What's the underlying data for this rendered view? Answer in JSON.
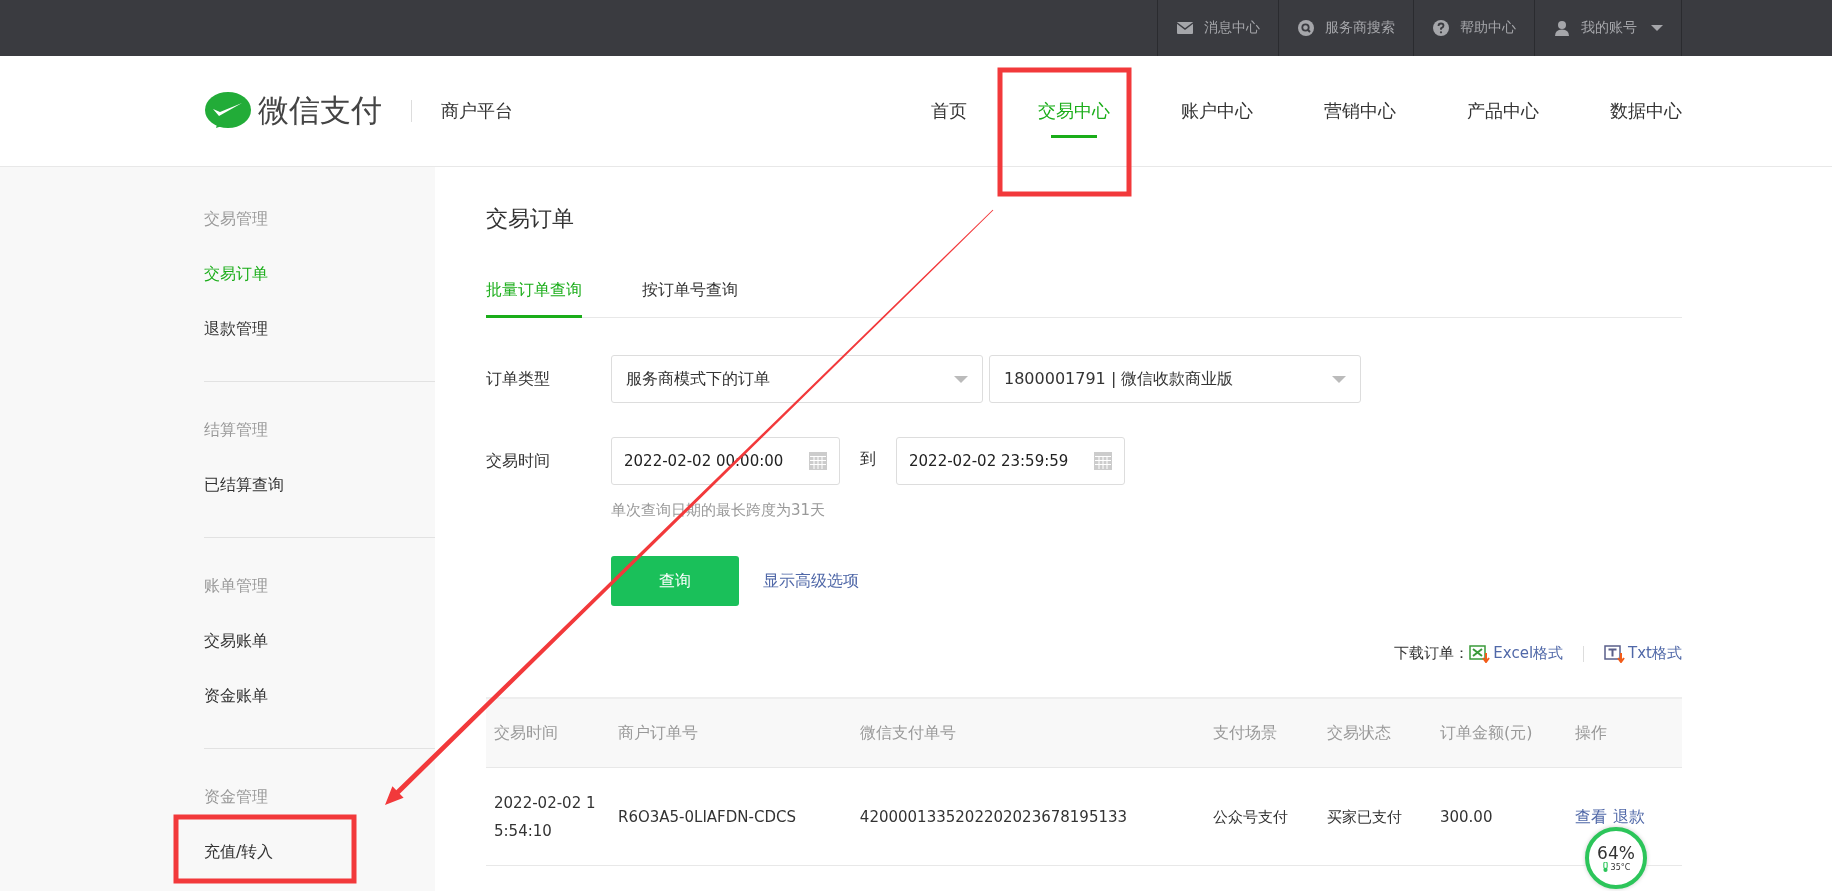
{
  "top_bar": {
    "items": [
      {
        "kind": "mail",
        "label": "消息中心"
      },
      {
        "kind": "search",
        "label": "服务商搜索"
      },
      {
        "kind": "help",
        "label": "帮助中心"
      },
      {
        "kind": "account",
        "label": "我的账号"
      }
    ]
  },
  "header": {
    "logo_text": "微信支付",
    "platform": "商户平台",
    "nav": [
      {
        "label": "首页",
        "selected": false
      },
      {
        "label": "交易中心",
        "selected": true
      },
      {
        "label": "账户中心",
        "selected": false
      },
      {
        "label": "营销中心",
        "selected": false
      },
      {
        "label": "产品中心",
        "selected": false
      },
      {
        "label": "数据中心",
        "selected": false
      }
    ]
  },
  "sidebar": {
    "groups": [
      {
        "title": "交易管理",
        "items": [
          {
            "label": "交易订单",
            "selected": true
          },
          {
            "label": "退款管理",
            "selected": false
          }
        ]
      },
      {
        "title": "结算管理",
        "items": [
          {
            "label": "已结算查询",
            "selected": false
          }
        ]
      },
      {
        "title": "账单管理",
        "items": [
          {
            "label": "交易账单",
            "selected": false
          },
          {
            "label": "资金账单",
            "selected": false
          }
        ]
      },
      {
        "title": "资金管理",
        "items": [
          {
            "label": "充值/转入",
            "selected": false
          }
        ]
      }
    ]
  },
  "page": {
    "title": "交易订单",
    "tabs": [
      {
        "label": "批量订单查询",
        "selected": true
      },
      {
        "label": "按订单号查询",
        "selected": false
      }
    ],
    "order_type": {
      "label": "订单类型",
      "selects": [
        "服务商模式下的订单",
        "1800001791 | 微信收款商业版"
      ]
    },
    "time": {
      "label": "交易时间",
      "start": "2022-02-02 00:00:00",
      "separator": "到",
      "end": "2022-02-02 23:59:59",
      "hint": "单次查询日期的最长跨度为31天"
    },
    "query_button": "查询",
    "advanced_link": "显示高级选项",
    "download": {
      "label": "下载订单：",
      "links": [
        {
          "kind": "excel",
          "label": "Excel格式"
        },
        {
          "kind": "txt",
          "label": "Txt格式"
        }
      ]
    },
    "table": {
      "columns": [
        "交易时间",
        "商户订单号",
        "微信支付单号",
        "支付场景",
        "交易状态",
        "订单金额(元)",
        "操作"
      ],
      "rows": [
        {
          "cells": [
            "2022-02-02 15:54:10",
            "R6O3A5-0LIAFDN-CDCS",
            "4200001335202202023678195133",
            "公众号支付",
            "买家已支付",
            "300.00"
          ],
          "actions": [
            "查看",
            "退款"
          ]
        }
      ]
    }
  },
  "monitor_widget": {
    "percent": "64%",
    "temperature": "35°C"
  }
}
